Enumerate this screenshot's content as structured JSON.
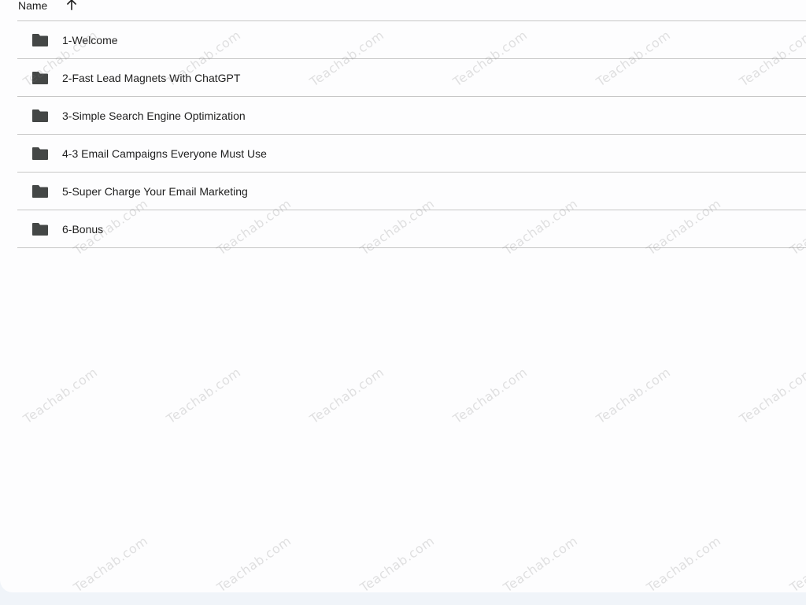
{
  "header": {
    "name_label": "Name",
    "sort_icon": "arrow-up-icon"
  },
  "files": [
    {
      "label": "1-Welcome",
      "icon": "folder-icon"
    },
    {
      "label": "2-Fast Lead Magnets With ChatGPT",
      "icon": "folder-icon"
    },
    {
      "label": "3-Simple Search Engine Optimization",
      "icon": "folder-icon"
    },
    {
      "label": "4-3 Email Campaigns Everyone Must Use",
      "icon": "folder-icon"
    },
    {
      "label": "5-Super Charge Your Email Marketing",
      "icon": "folder-icon"
    },
    {
      "label": "6-Bonus",
      "icon": "folder-icon"
    }
  ],
  "watermark": "Teachab.com",
  "colors": {
    "background": "#f0f4f9",
    "panel": "#fdfdfe",
    "divider": "#c7c7c7",
    "icon": "#444746",
    "text": "#1f1f1f"
  }
}
